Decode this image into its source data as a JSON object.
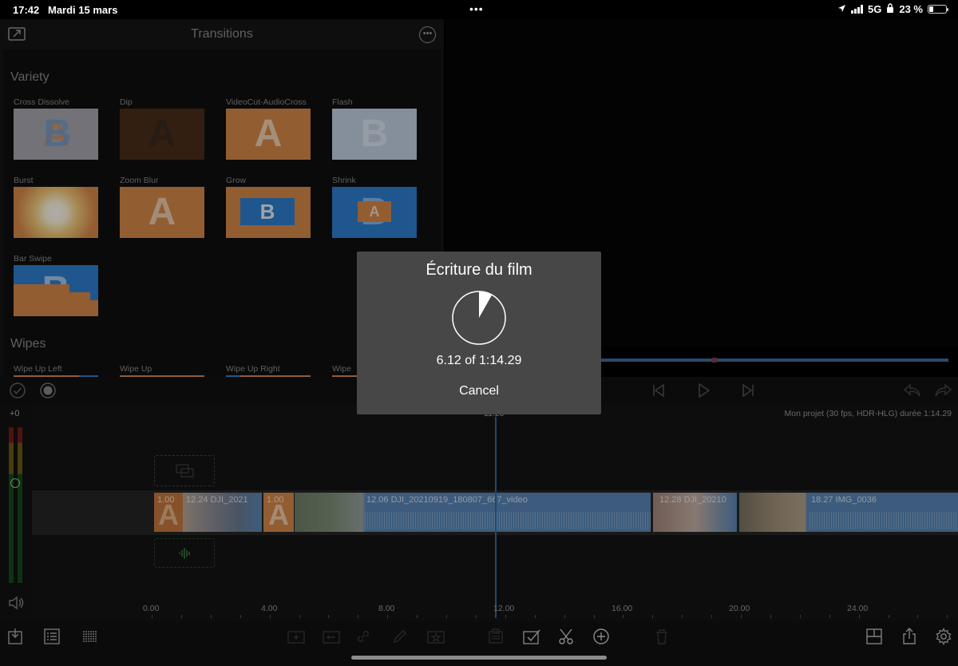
{
  "statusbar": {
    "time": "17:42",
    "date": "Mardi 15 mars",
    "network": "5G",
    "battery": "23 %"
  },
  "panel": {
    "title": "Transitions",
    "sections": [
      {
        "title": "Variety"
      },
      {
        "title": "Wipes"
      }
    ],
    "variety": [
      {
        "label": "Cross Dissolve"
      },
      {
        "label": "Dip"
      },
      {
        "label": "VideoCut-AudioCross"
      },
      {
        "label": "Flash"
      },
      {
        "label": "Burst"
      },
      {
        "label": "Zoom Blur"
      },
      {
        "label": "Grow"
      },
      {
        "label": "Shrink"
      },
      {
        "label": "Bar Swipe"
      }
    ],
    "wipes": [
      {
        "label": "Wipe Up Left"
      },
      {
        "label": "Wipe Up"
      },
      {
        "label": "Wipe Up Right"
      },
      {
        "label": "Wipe"
      }
    ],
    "thumb_letters": {
      "a": "A",
      "b": "B"
    }
  },
  "timeline": {
    "db_level": "+0",
    "project_info": "Mon projet (30 fps, HDR-HLG) durée 1:14.29",
    "playhead_label": "11.20",
    "clips": [
      {
        "text": "1.00"
      },
      {
        "text": "12.24  DJI_2021"
      },
      {
        "text": "1.00"
      },
      {
        "text": "12.06  DJI_20210919_180807_667_video"
      },
      {
        "text": "12.28  DJI_20210"
      },
      {
        "text": "18.27  IMG_0036"
      }
    ],
    "ruler": [
      "0.00",
      "4.00",
      "8.00",
      "12.00",
      "16.00",
      "20.00",
      "24.00"
    ]
  },
  "modal": {
    "title": "Écriture du film",
    "progress": "6.12 of 1:14.29",
    "progress_fraction": 0.082,
    "cancel_label": "Cancel"
  },
  "colors": {
    "accent": "#2c6ea8",
    "clip_blue": "#5b88b8",
    "transition_orange": "#d98a4a",
    "modal_bg": "#474747"
  }
}
